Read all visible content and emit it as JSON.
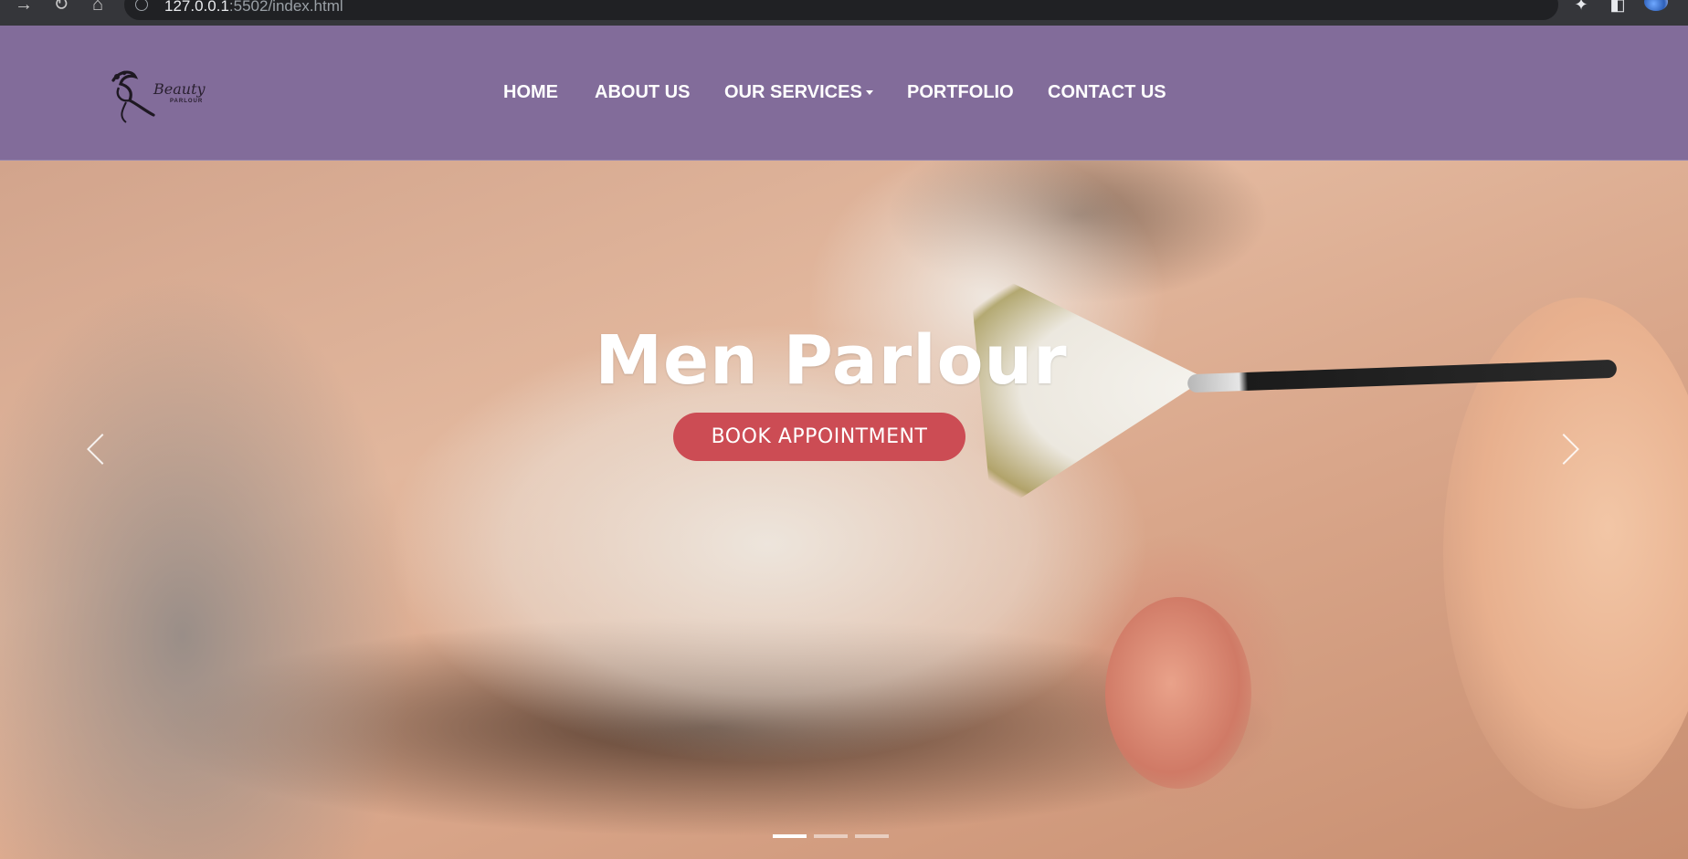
{
  "browser": {
    "url_host": "127.0.0.1",
    "url_rest": ":5502/index.html",
    "icons": [
      "back-icon",
      "reload-icon",
      "home-icon",
      "info-icon",
      "share-icon",
      "star-icon",
      "extensions-icon",
      "sidebar-icon",
      "profile-avatar"
    ]
  },
  "site": {
    "logo": {
      "brand": "Beauty",
      "subtitle": "PARLOUR"
    },
    "nav": [
      {
        "label": "HOME"
      },
      {
        "label": "ABOUT US"
      },
      {
        "label": "OUR SERVICES",
        "has_dropdown": true
      },
      {
        "label": "PORTFOLIO"
      },
      {
        "label": "CONTACT US"
      }
    ],
    "colors": {
      "header": "#826c9a",
      "button": "#cc4c54"
    }
  },
  "hero": {
    "title": "Men Parlour",
    "button": "BOOK APPOINTMENT",
    "active_slide": 1,
    "slide_count": 3
  }
}
